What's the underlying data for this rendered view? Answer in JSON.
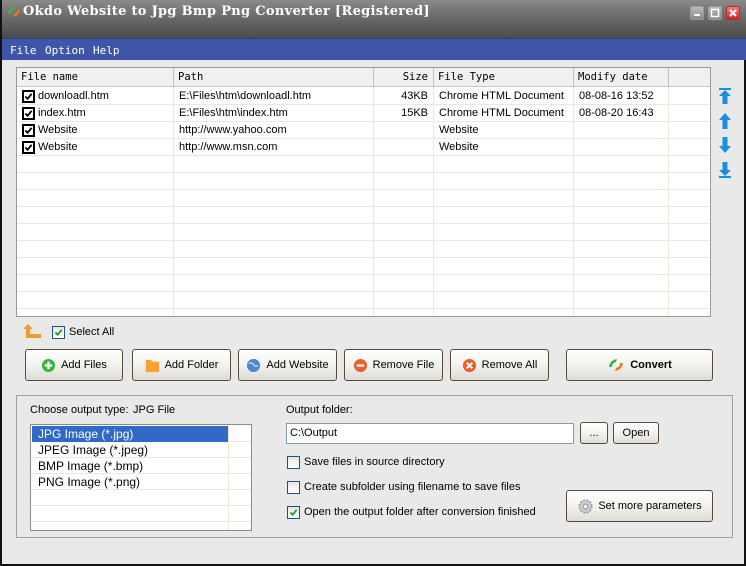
{
  "window": {
    "title": "Okdo Website to Jpg Bmp Png Converter [Registered]",
    "controls": [
      "minimize",
      "maximize",
      "close"
    ]
  },
  "menu": {
    "items": [
      {
        "label": "File"
      },
      {
        "label": "Option"
      },
      {
        "label": "Help"
      }
    ]
  },
  "file_table": {
    "columns": [
      {
        "label": "File name"
      },
      {
        "label": "Path"
      },
      {
        "label": "Size"
      },
      {
        "label": "File Type"
      },
      {
        "label": "Modify date"
      }
    ],
    "rows": [
      {
        "checked": true,
        "name": "downloadl.htm",
        "path": "E:\\Files\\htm\\downloadl.htm",
        "size": "43KB",
        "type": "Chrome HTML Document",
        "date": "08-08-16 13:52"
      },
      {
        "checked": true,
        "name": "index.htm",
        "path": "E:\\Files\\htm\\index.htm",
        "size": "15KB",
        "type": "Chrome HTML Document",
        "date": "08-08-20 16:43"
      },
      {
        "checked": true,
        "name": "Website",
        "path": "http://www.yahoo.com",
        "size": "",
        "type": "Website",
        "date": ""
      },
      {
        "checked": true,
        "name": "Website",
        "path": "http://www.msn.com",
        "size": "",
        "type": "Website",
        "date": ""
      }
    ]
  },
  "side_controls": {
    "icons": [
      "move-top-icon",
      "move-up-icon",
      "move-down-icon",
      "move-bottom-icon"
    ]
  },
  "select_all": {
    "label": "Select All",
    "checked": true
  },
  "toolbar": {
    "add_files": "Add Files",
    "add_folder": "Add Folder",
    "add_website": "Add Website",
    "remove_file": "Remove File",
    "remove_all": "Remove All",
    "convert": "Convert"
  },
  "output": {
    "choose_type_label": "Choose output type:",
    "choose_type_value": "JPG File",
    "types": [
      {
        "label": "JPG Image (*.jpg)",
        "selected": true
      },
      {
        "label": "JPEG Image (*.jpeg)",
        "selected": false
      },
      {
        "label": "BMP Image (*.bmp)",
        "selected": false
      },
      {
        "label": "PNG Image (*.png)",
        "selected": false
      }
    ],
    "folder_label": "Output folder:",
    "folder_value": "C:\\Output",
    "browse_label": "...",
    "open_label": "Open",
    "options": [
      {
        "label": "Save files in source directory",
        "checked": false
      },
      {
        "label": "Create subfolder using filename to save files",
        "checked": false
      },
      {
        "label": "Open the output folder after conversion finished",
        "checked": true
      }
    ],
    "more_params_label": "Set more parameters"
  },
  "colors": {
    "menubar": "#3f56a8",
    "selection": "#3169c6",
    "arrow_blue": "#1a8fe0",
    "accent_orange": "#f39a2a"
  }
}
